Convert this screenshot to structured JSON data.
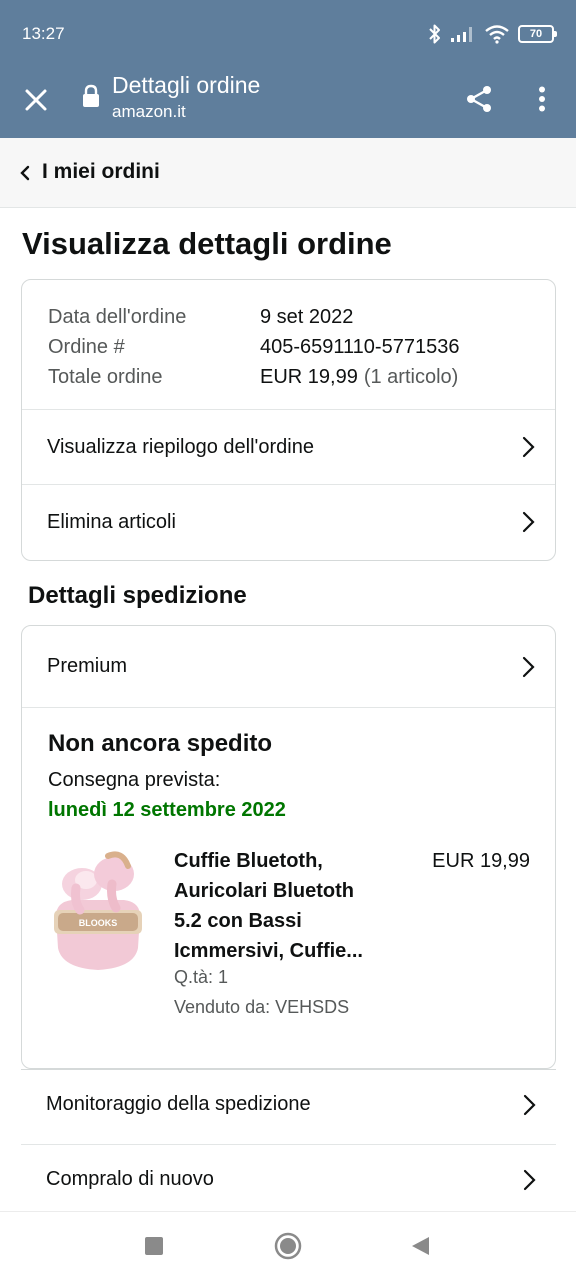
{
  "status_bar": {
    "time": "13:27",
    "battery": "70",
    "icons": [
      "bluetooth-icon",
      "signal-icon",
      "wifi-icon",
      "battery-icon"
    ]
  },
  "browser": {
    "title": "Dettagli ordine",
    "url": "amazon.it",
    "icons": [
      "close-icon",
      "lock-icon",
      "share-icon",
      "more-vert-icon"
    ]
  },
  "back_nav": {
    "label": "I miei ordini"
  },
  "page_title": "Visualizza dettagli ordine",
  "order_summary": {
    "rows": [
      {
        "label": "Data dell'ordine",
        "value": "9 set 2022"
      },
      {
        "label": "Ordine #",
        "value": "405-6591110-5771536"
      },
      {
        "label": "Totale ordine",
        "value": "EUR 19,99",
        "extra": "(1 articolo)"
      }
    ],
    "links": [
      "Visualizza riepilogo dell'ordine",
      "Elimina articoli"
    ]
  },
  "shipping": {
    "section_title": "Dettagli spedizione",
    "method": "Premium",
    "status": "Non ancora spedito",
    "expected_label": "Consegna prevista:",
    "expected_date": "lunedì 12 settembre 2022",
    "product": {
      "name_lines": [
        "Cuffie Bluetoth,",
        "Auricolari Bluetoth",
        "5.2 con Bassi",
        "Icmmersivi, Cuffie..."
      ],
      "price": "EUR 19,99",
      "qty": "Q.tà: 1",
      "seller": "Venduto da: VEHSDS",
      "image_text": "BLOOKS"
    }
  },
  "actions": [
    "Monitoraggio della spedizione",
    "Compralo di nuovo"
  ],
  "nav_bar": {
    "icons": [
      "recents-icon",
      "home-icon",
      "back-icon"
    ]
  },
  "colors": {
    "toolbar": "#5f7e9c",
    "delivery_green": "#007600",
    "text": "#0f1111",
    "muted": "#565959",
    "border": "#d5d9d9"
  }
}
